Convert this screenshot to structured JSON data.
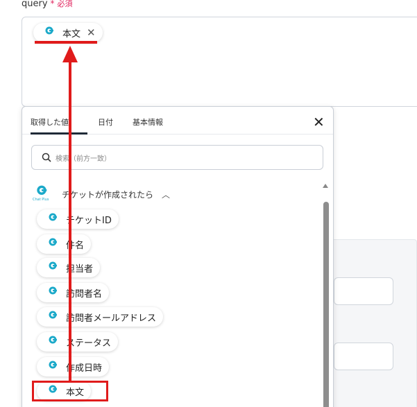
{
  "field": {
    "label": "query",
    "required_mark": "*",
    "required_text": "必須",
    "chip_label": "本文",
    "chip_close": "✕"
  },
  "popup": {
    "tabs": [
      {
        "label": "取得した値",
        "active": true
      },
      {
        "label": "日付",
        "active": false
      },
      {
        "label": "基本情報",
        "active": false
      }
    ],
    "close": "✕",
    "search_placeholder": "検索（前方一致）",
    "section": {
      "title": "チケットが作成されたら",
      "logo_text": "Chat Plus",
      "items": [
        "チケットID",
        "件名",
        "担当者",
        "訪問者名",
        "訪問者メールアドレス",
        "ステータス",
        "作成日時",
        "本文"
      ]
    }
  },
  "colors": {
    "brand": "#1ba9c9",
    "annotation": "#e01b1b",
    "required": "#e0245e"
  }
}
